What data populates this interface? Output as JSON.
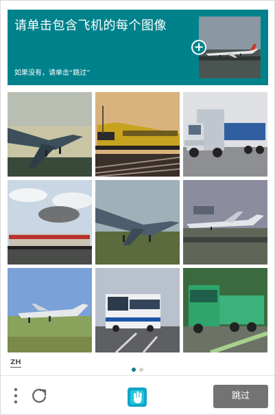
{
  "header": {
    "title": "请单击包含飞机的每个图像",
    "subtitle": "如果没有，请单击“跳过”"
  },
  "tiles": [
    {
      "subject": "airplane",
      "selected": false
    },
    {
      "subject": "train",
      "selected": false
    },
    {
      "subject": "truck",
      "selected": false
    },
    {
      "subject": "train",
      "selected": false
    },
    {
      "subject": "airplane",
      "selected": false
    },
    {
      "subject": "airplane",
      "selected": false
    },
    {
      "subject": "airplane",
      "selected": false
    },
    {
      "subject": "bus",
      "selected": false
    },
    {
      "subject": "truck",
      "selected": false
    }
  ],
  "footer": {
    "language": "ZH",
    "skip_label": "跳过",
    "pages": 2,
    "current_page": 1
  },
  "colors": {
    "accent": "#00828c",
    "skip_button": "#737373",
    "dot_active": "#00828c",
    "dot_inactive": "#cfcfcf"
  },
  "icons": {
    "menu": "vertical-dots-icon",
    "refresh": "refresh-icon",
    "logo": "hcaptcha-logo-icon",
    "add": "plus-icon"
  }
}
